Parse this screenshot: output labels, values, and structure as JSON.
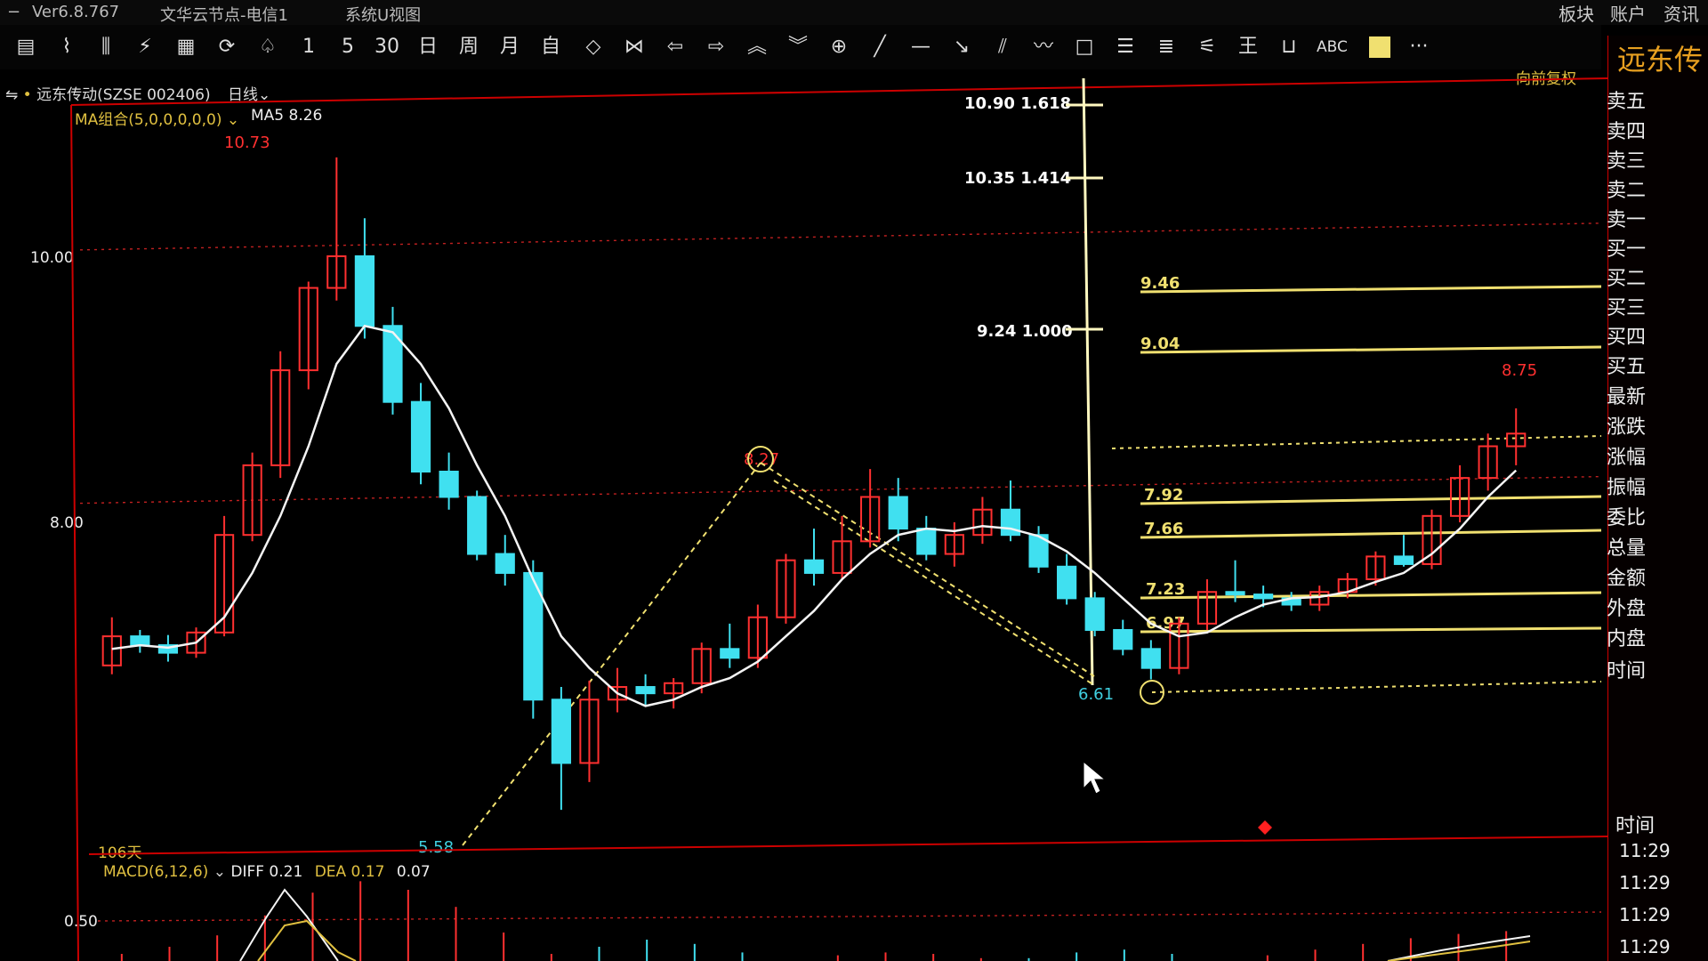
{
  "titlebar": {
    "version": "Ver6.8.767",
    "server": "文华云节点-电信1",
    "menu": "系统U视图",
    "right_items": [
      "板块",
      "账户",
      "资讯"
    ]
  },
  "toolbar": {
    "buttons": [
      "1",
      "5",
      "30",
      "日",
      "周",
      "月",
      "自"
    ],
    "abc_label": "ABC",
    "more_label": "···"
  },
  "stock": {
    "name_code": "远东传动(SZSE 002406)",
    "period": "日线",
    "ma_combo": "MA组合(5,0,0,0,0,0)",
    "ma5": "MA5 8.26",
    "adjust": "向前复权",
    "days": "106天"
  },
  "macd": {
    "label": "MACD(6,12,6)",
    "diff": "DIFF 0.21",
    "dea": "DEA 0.17",
    "macd_value": "0.07",
    "level_label": "0.50"
  },
  "price_axis": [
    "10.00",
    "8.00"
  ],
  "price_tags": {
    "high": "10.73",
    "low1": "5.58",
    "mid_high": "8.27",
    "low2": "6.61",
    "last_high": "8.75"
  },
  "fib_labels": [
    {
      "price": "10.90",
      "ratio": "1.618"
    },
    {
      "price": "10.35",
      "ratio": "1.414"
    },
    {
      "price": "9.24",
      "ratio": "1.000"
    }
  ],
  "horizontal_levels": [
    "9.46",
    "9.04",
    "7.92",
    "7.66",
    "7.23",
    "6.97"
  ],
  "quote_panel": {
    "title": "远东传",
    "labels": [
      "卖五",
      "卖四",
      "卖三",
      "卖二",
      "卖一",
      "买一",
      "买二",
      "买三",
      "买四",
      "买五",
      "最新",
      "涨跌",
      "涨幅",
      "振幅",
      "委比",
      "总量",
      "金额",
      "外盘",
      "内盘",
      "时间"
    ],
    "time_header": "时间",
    "times": [
      "11:29",
      "11:29",
      "11:29",
      "11:29"
    ]
  },
  "chart_data": {
    "type": "candlestick",
    "period": "daily",
    "ma": "MA5",
    "candles": [
      [
        6.72,
        7.1,
        6.65,
        6.95
      ],
      [
        6.95,
        7.0,
        6.82,
        6.88
      ],
      [
        6.88,
        6.96,
        6.75,
        6.82
      ],
      [
        6.82,
        7.02,
        6.78,
        6.98
      ],
      [
        6.98,
        7.9,
        6.95,
        7.75
      ],
      [
        7.75,
        8.4,
        7.7,
        8.3
      ],
      [
        8.3,
        9.2,
        8.2,
        9.05
      ],
      [
        9.05,
        9.75,
        8.9,
        9.7
      ],
      [
        9.7,
        10.73,
        9.6,
        9.95
      ],
      [
        9.95,
        10.25,
        9.3,
        9.4
      ],
      [
        9.4,
        9.55,
        8.7,
        8.8
      ],
      [
        8.8,
        8.95,
        8.15,
        8.25
      ],
      [
        8.25,
        8.4,
        7.95,
        8.05
      ],
      [
        8.05,
        8.1,
        7.55,
        7.6
      ],
      [
        7.6,
        7.75,
        7.35,
        7.45
      ],
      [
        7.45,
        7.55,
        6.3,
        6.45
      ],
      [
        6.45,
        6.55,
        5.58,
        5.95
      ],
      [
        5.95,
        6.6,
        5.8,
        6.45
      ],
      [
        6.45,
        6.7,
        6.35,
        6.55
      ],
      [
        6.55,
        6.65,
        6.4,
        6.5
      ],
      [
        6.5,
        6.62,
        6.38,
        6.58
      ],
      [
        6.58,
        6.9,
        6.5,
        6.85
      ],
      [
        6.85,
        7.05,
        6.7,
        6.78
      ],
      [
        6.78,
        7.2,
        6.7,
        7.1
      ],
      [
        7.1,
        7.6,
        7.05,
        7.55
      ],
      [
        7.55,
        7.8,
        7.35,
        7.45
      ],
      [
        7.45,
        7.9,
        7.4,
        7.7
      ],
      [
        7.7,
        8.27,
        7.65,
        8.05
      ],
      [
        8.05,
        8.2,
        7.7,
        7.8
      ],
      [
        7.8,
        7.9,
        7.55,
        7.6
      ],
      [
        7.6,
        7.85,
        7.5,
        7.75
      ],
      [
        7.75,
        8.05,
        7.68,
        7.95
      ],
      [
        7.95,
        8.18,
        7.7,
        7.75
      ],
      [
        7.75,
        7.82,
        7.45,
        7.5
      ],
      [
        7.5,
        7.6,
        7.2,
        7.25
      ],
      [
        7.25,
        7.3,
        6.95,
        7.0
      ],
      [
        7.0,
        7.08,
        6.8,
        6.85
      ],
      [
        6.85,
        6.92,
        6.61,
        6.7
      ],
      [
        6.7,
        7.1,
        6.65,
        7.05
      ],
      [
        7.05,
        7.4,
        7.0,
        7.3
      ],
      [
        7.3,
        7.55,
        7.22,
        7.28
      ],
      [
        7.28,
        7.35,
        7.18,
        7.25
      ],
      [
        7.25,
        7.3,
        7.15,
        7.2
      ],
      [
        7.2,
        7.35,
        7.15,
        7.3
      ],
      [
        7.3,
        7.45,
        7.25,
        7.4
      ],
      [
        7.4,
        7.62,
        7.35,
        7.58
      ],
      [
        7.58,
        7.75,
        7.5,
        7.52
      ],
      [
        7.52,
        7.95,
        7.48,
        7.9
      ],
      [
        7.9,
        8.3,
        7.85,
        8.2
      ],
      [
        8.2,
        8.55,
        8.1,
        8.45
      ],
      [
        8.45,
        8.75,
        8.3,
        8.55
      ]
    ],
    "ma5": [
      6.85,
      6.88,
      6.86,
      6.9,
      7.1,
      7.45,
      7.9,
      8.45,
      9.1,
      9.4,
      9.35,
      9.1,
      8.75,
      8.3,
      7.9,
      7.4,
      6.95,
      6.7,
      6.5,
      6.4,
      6.45,
      6.55,
      6.62,
      6.75,
      6.95,
      7.15,
      7.4,
      7.6,
      7.75,
      7.8,
      7.78,
      7.82,
      7.8,
      7.74,
      7.62,
      7.45,
      7.25,
      7.05,
      6.95,
      6.98,
      7.1,
      7.2,
      7.25,
      7.26,
      7.3,
      7.38,
      7.45,
      7.6,
      7.8,
      8.05,
      8.26
    ],
    "y_range": [
      5.3,
      11.2
    ],
    "macd_hist": [
      0.05,
      0.1,
      0.18,
      0.32,
      0.48,
      0.56,
      0.5,
      0.38,
      0.2,
      0.05,
      -0.1,
      -0.15,
      -0.12,
      -0.06,
      0.0,
      0.04,
      0.06,
      0.05,
      0.02,
      -0.02,
      -0.06,
      -0.08,
      -0.05,
      0.0,
      0.04,
      0.08,
      0.12,
      0.16,
      0.19,
      0.21
    ]
  }
}
